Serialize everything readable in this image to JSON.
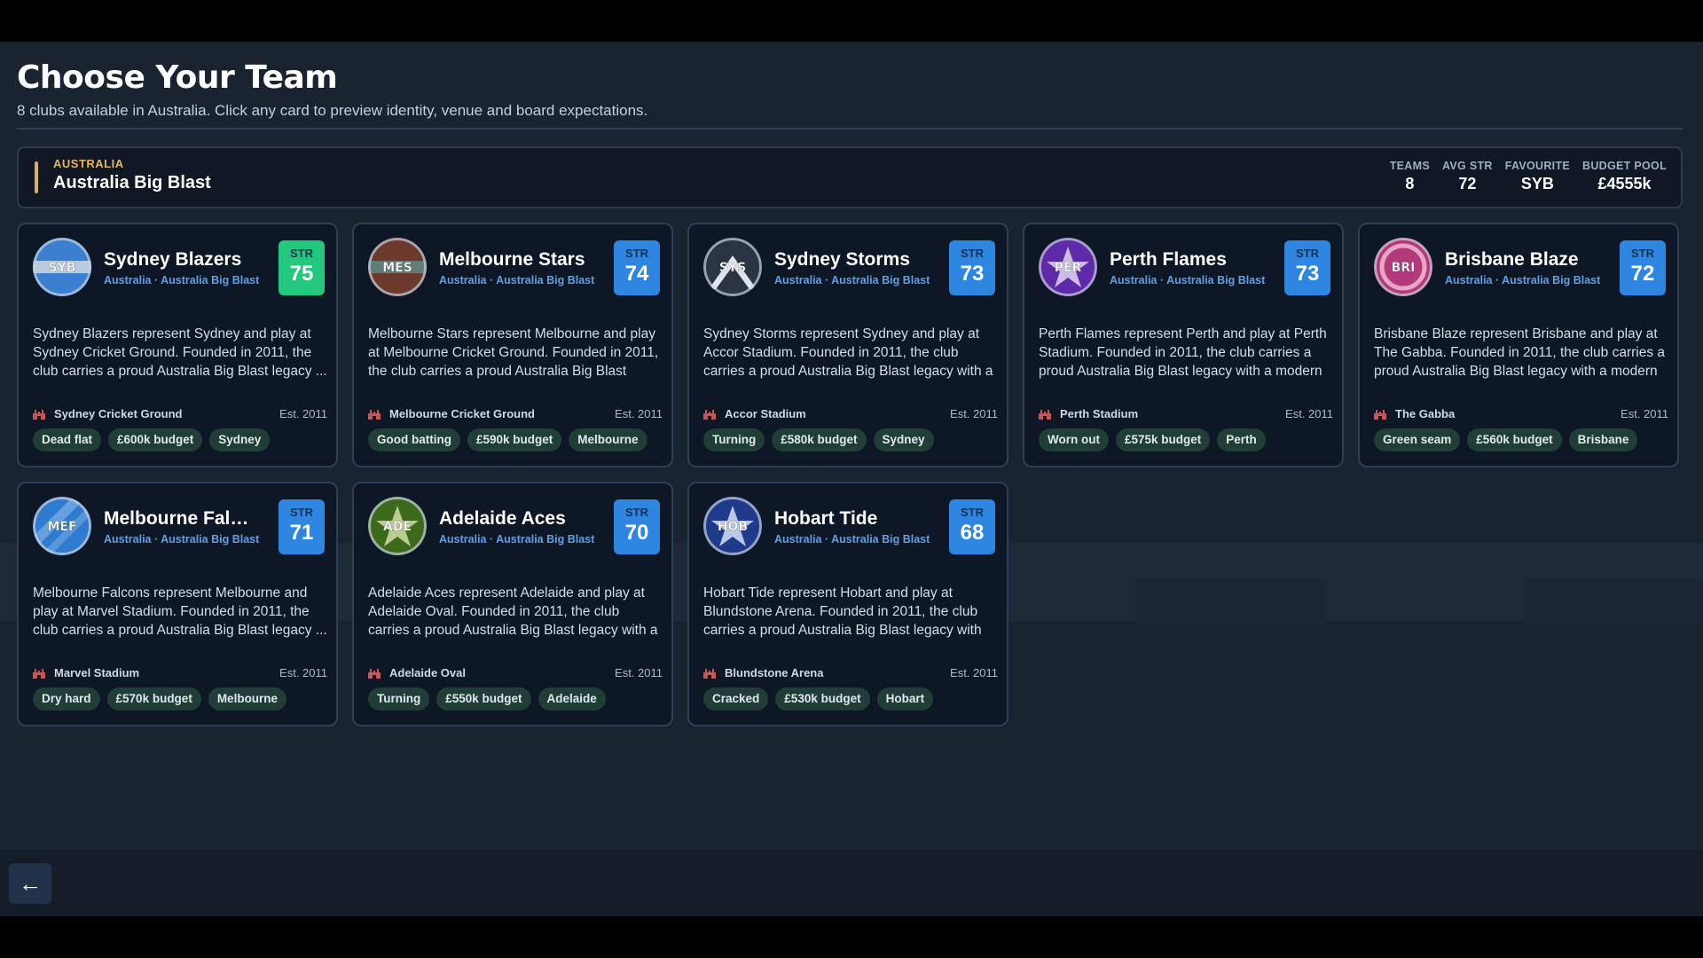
{
  "header": {
    "title": "Choose Your Team",
    "subtitle": "8 clubs available in Australia. Click any card to preview identity, venue and board expectations."
  },
  "league": {
    "country": "AUSTRALIA",
    "name": "Australia Big Blast",
    "stats": [
      {
        "label": "TEAMS",
        "value": "8"
      },
      {
        "label": "AVG STR",
        "value": "72"
      },
      {
        "label": "FAVOURITE",
        "value": "SYB"
      },
      {
        "label": "BUDGET POOL",
        "value": "£4555k"
      }
    ]
  },
  "str_label": "STR",
  "footer": {
    "back_icon": "←"
  },
  "teams": [
    {
      "name": "Sydney Blazers",
      "abbr": "SYB",
      "meta": "Australia · Australia Big Blast",
      "str": "75",
      "str_color": "#23c77d",
      "badge": {
        "pattern": "band",
        "primary": "#3b7fd0",
        "secondary": "#cfd8e4"
      },
      "description": "Sydney Blazers represent Sydney and play at Sydney Cricket Ground. Founded in 2011, the club carries a proud Australia Big Blast legacy ...",
      "venue": "Sydney Cricket Ground",
      "est": "Est. 2011",
      "tags": [
        "Dead flat",
        "£600k budget",
        "Sydney"
      ]
    },
    {
      "name": "Melbourne Stars",
      "abbr": "MES",
      "meta": "Australia · Australia Big Blast",
      "str": "74",
      "str_color": "#2f86e0",
      "badge": {
        "pattern": "band",
        "primary": "#6b3a2c",
        "secondary": "#5f8a84"
      },
      "description": "Melbourne Stars represent Melbourne and play at Melbourne Cricket Ground. Founded in 2011, the club carries a proud Australia Big Blast lega...",
      "venue": "Melbourne Cricket Ground",
      "est": "Est. 2011",
      "tags": [
        "Good batting",
        "£590k budget",
        "Melbourne"
      ]
    },
    {
      "name": "Sydney Storms",
      "abbr": "SYS",
      "meta": "Australia · Australia Big Blast",
      "str": "73",
      "str_color": "#2f86e0",
      "badge": {
        "pattern": "chevron",
        "primary": "#2b3442",
        "secondary": "#dfe5ec"
      },
      "description": "Sydney Storms represent Sydney and play at Accor Stadium. Founded in 2011, the club carries a proud Australia Big Blast legacy with a moder...",
      "venue": "Accor Stadium",
      "est": "Est. 2011",
      "tags": [
        "Turning",
        "£580k budget",
        "Sydney"
      ]
    },
    {
      "name": "Perth Flames",
      "abbr": "PER",
      "meta": "Australia · Australia Big Blast",
      "str": "73",
      "str_color": "#2f86e0",
      "badge": {
        "pattern": "star",
        "primary": "#5e2aa8",
        "secondary": "#d8cdea"
      },
      "description": "Perth Flames represent Perth and play at Perth Stadium. Founded in 2011, the club carries a proud Australia Big Blast legacy with a modern ...",
      "venue": "Perth Stadium",
      "est": "Est. 2011",
      "tags": [
        "Worn out",
        "£575k budget",
        "Perth"
      ]
    },
    {
      "name": "Brisbane Blaze",
      "abbr": "BRI",
      "meta": "Australia · Australia Big Blast",
      "str": "72",
      "str_color": "#2f86e0",
      "badge": {
        "pattern": "ring",
        "primary": "#b2397a",
        "secondary": "#e7a6c6"
      },
      "description": "Brisbane Blaze represent Brisbane and play at The Gabba. Founded in 2011, the club carries a proud Australia Big Blast legacy with a modern ...",
      "venue": "The Gabba",
      "est": "Est. 2011",
      "tags": [
        "Green seam",
        "£560k budget",
        "Brisbane"
      ]
    },
    {
      "name": "Melbourne Falcons",
      "abbr": "MEF",
      "meta": "Australia · Australia Big Blast",
      "str": "71",
      "str_color": "#2f86e0",
      "badge": {
        "pattern": "stripes",
        "primary": "#2f7bd0",
        "secondary": "#a9cbef"
      },
      "description": "Melbourne Falcons represent Melbourne and play at Marvel Stadium. Founded in 2011, the club carries a proud Australia Big Blast legacy ...",
      "venue": "Marvel Stadium",
      "est": "Est. 2011",
      "tags": [
        "Dry hard",
        "£570k budget",
        "Melbourne"
      ]
    },
    {
      "name": "Adelaide Aces",
      "abbr": "ADE",
      "meta": "Australia · Australia Big Blast",
      "str": "70",
      "str_color": "#2f86e0",
      "badge": {
        "pattern": "star",
        "primary": "#3d6a1a",
        "secondary": "#c9d7a0"
      },
      "description": "Adelaide Aces represent Adelaide and play at Adelaide Oval. Founded in 2011, the club carries a proud Australia Big Blast legacy with a moder...",
      "venue": "Adelaide Oval",
      "est": "Est. 2011",
      "tags": [
        "Turning",
        "£550k budget",
        "Adelaide"
      ]
    },
    {
      "name": "Hobart Tide",
      "abbr": "HOB",
      "meta": "Australia · Australia Big Blast",
      "str": "68",
      "str_color": "#2f86e0",
      "badge": {
        "pattern": "star",
        "primary": "#1f3a8a",
        "secondary": "#cdd6ee"
      },
      "description": "Hobart Tide represent Hobart and play at Blundstone Arena. Founded in 2011, the club carries a proud Australia Big Blast legacy with a...",
      "venue": "Blundstone Arena",
      "est": "Est. 2011",
      "tags": [
        "Cracked",
        "£530k budget",
        "Hobart"
      ]
    }
  ]
}
